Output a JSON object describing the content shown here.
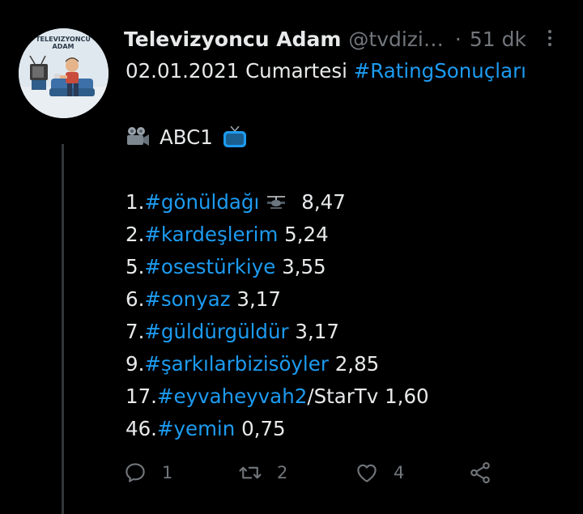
{
  "tweet": {
    "display_name": "Televizyoncu Adam",
    "handle": "@tvdizi…",
    "separator": "·",
    "time": "51 dk",
    "avatar_text": [
      "TELEVIZYONCU",
      "ADAM"
    ],
    "first_line_date": "02.01.2021 Cumartesi",
    "first_line_tag": "#RatingSonuçları",
    "channel": "ABC1",
    "ratings": [
      {
        "rank": "1.",
        "tag": "#gönüldağı",
        "value": "8,47"
      },
      {
        "rank": "2.",
        "tag": "#kardeşlerim",
        "value": "5,24"
      },
      {
        "rank": "5.",
        "tag": "#osestürkiye",
        "value": "3,55"
      },
      {
        "rank": "6.",
        "tag": "#sonyaz",
        "value": "3,17"
      },
      {
        "rank": "7.",
        "tag": "#güldürgüldür",
        "value": "3,17"
      },
      {
        "rank": "9.",
        "tag": "#şarkılarbizisöyler",
        "value": "2,85"
      },
      {
        "rank": "17.",
        "tag": "#eyvaheyvah2",
        "suffix": "/StarTv",
        "value": "1,60"
      },
      {
        "rank": "46.",
        "tag": "#yemin",
        "value": "0,75"
      }
    ]
  },
  "actions": {
    "reply_count": "1",
    "retweet_count": "2",
    "like_count": "4"
  },
  "icons": {
    "reply": "reply-icon",
    "retweet": "retweet-icon",
    "like": "heart-icon",
    "share": "share-icon",
    "more": "more-options-icon"
  },
  "colors": {
    "background": "#000000",
    "text": "#e7e9ea",
    "muted": "#71767b",
    "link": "#1d9bf0"
  }
}
